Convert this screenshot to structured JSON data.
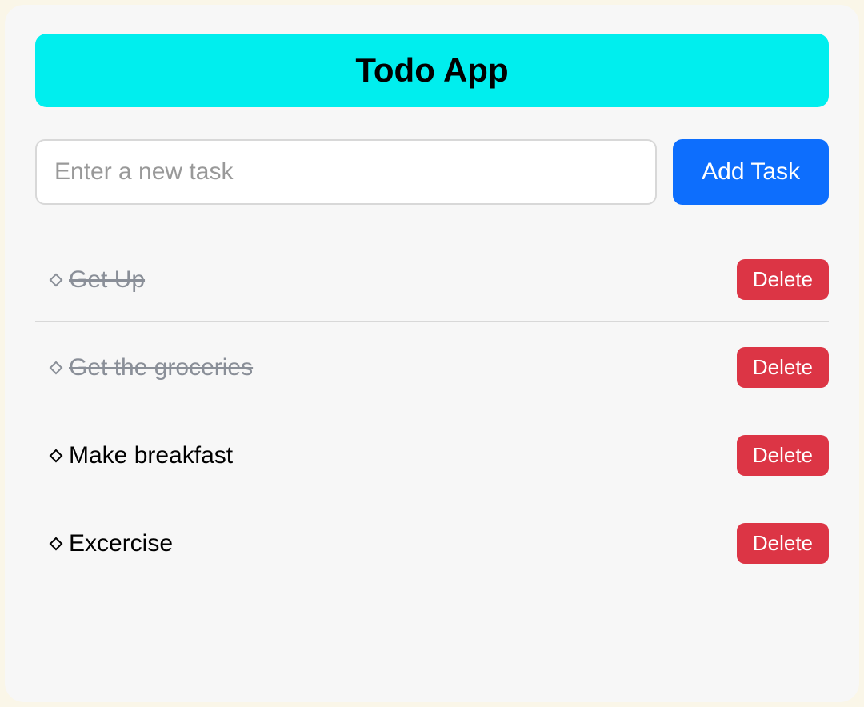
{
  "header": {
    "title": "Todo App"
  },
  "input": {
    "placeholder": "Enter a new task",
    "value": ""
  },
  "buttons": {
    "add": "Add Task",
    "delete": "Delete"
  },
  "tasks": [
    {
      "text": "Get Up",
      "completed": true
    },
    {
      "text": "Get the groceries",
      "completed": true
    },
    {
      "text": "Make breakfast",
      "completed": false
    },
    {
      "text": "Excercise",
      "completed": false
    }
  ]
}
